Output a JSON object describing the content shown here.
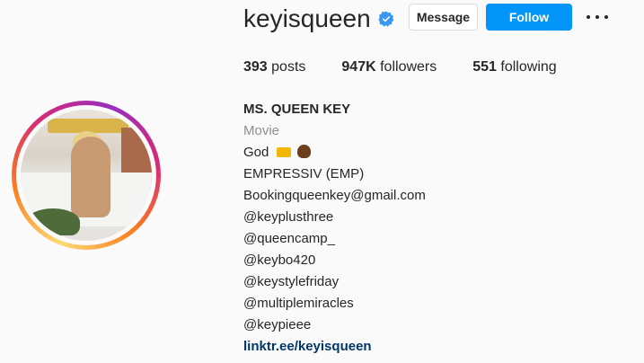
{
  "profile": {
    "username": "keyisqueen",
    "verified": true,
    "message_label": "Message",
    "follow_label": "Follow",
    "follow_color": "#0095f6"
  },
  "stats": {
    "posts_count": "393",
    "posts_label": "posts",
    "followers_count": "947K",
    "followers_label": "followers",
    "following_count": "551",
    "following_label": "following"
  },
  "bio": {
    "full_name": "MS. QUEEN KEY",
    "category": "Movie",
    "line_god": "God",
    "emojis": [
      "crown-emoji",
      "pile-of-poo-emoji"
    ],
    "lines": [
      "EMPRESSIV (EMP)",
      "Bookingqueenkey@gmail.com",
      "@keyplusthree",
      "@queencamp_",
      "@keybo420",
      "@keystylefriday",
      "@multiplemiracles",
      "@keypieee"
    ],
    "link": "linktr.ee/keyisqueen"
  }
}
